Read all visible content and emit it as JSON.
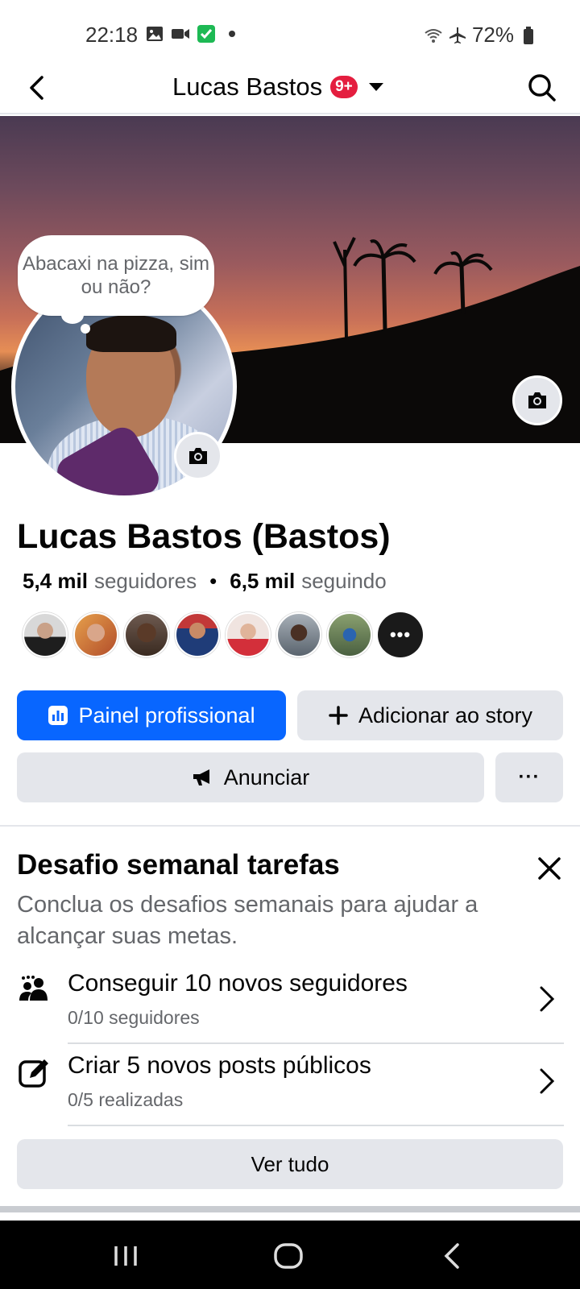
{
  "status_bar": {
    "time": "22:18",
    "battery": "72%",
    "icons_left": [
      "image-icon",
      "video-icon",
      "check-shield-icon",
      "dot-icon"
    ],
    "icons_right": [
      "wifi-icon",
      "airplane-icon",
      "battery-icon"
    ]
  },
  "header": {
    "title": "Lucas Bastos",
    "badge": "9+"
  },
  "note": {
    "text": "Abacaxi na pizza, sim ou não?"
  },
  "profile": {
    "name": "Lucas Bastos (Bastos)",
    "followers_count": "5,4 mil",
    "followers_label": "seguidores",
    "separator": "•",
    "following_count": "6,5 mil",
    "following_label": "seguindo",
    "friends_more": "•••"
  },
  "actions": {
    "dashboard": "Painel profissional",
    "add_story": "Adicionar ao story",
    "advertise": "Anunciar",
    "more": "···"
  },
  "challenge": {
    "title": "Desafio semanal tarefas",
    "description": "Conclua os desafios semanais para ajudar a alcançar suas metas.",
    "tasks": [
      {
        "title": "Conseguir 10 novos seguidores",
        "progress": "0/10 seguidores"
      },
      {
        "title": "Criar 5 novos posts públicos",
        "progress": "0/5 realizadas"
      }
    ],
    "see_all": "Ver tudo"
  },
  "colors": {
    "primary": "#0866ff",
    "secondary_bg": "#e4e6eb",
    "badge": "#e41e3f",
    "text": "#050505",
    "muted": "#65676b"
  }
}
